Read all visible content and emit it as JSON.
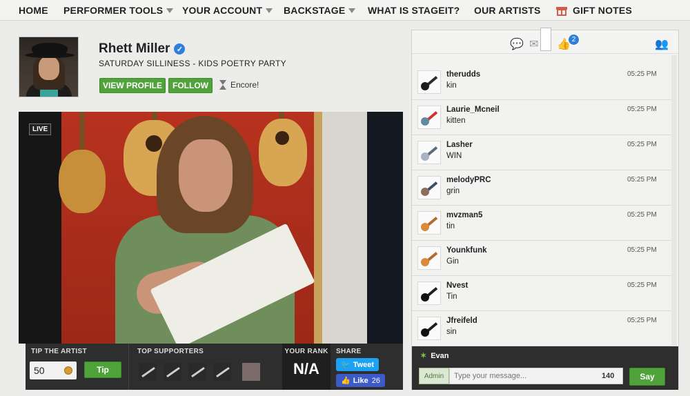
{
  "nav": {
    "home": "HOME",
    "performer_tools": "PERFORMER TOOLS",
    "your_account": "YOUR ACCOUNT",
    "backstage": "BACKSTAGE",
    "what_is": "WHAT IS STAGEIT?",
    "our_artists": "OUR ARTISTS",
    "gift_notes": "GIFT NOTES"
  },
  "profile": {
    "name": "Rhett Miller",
    "show_title": "SATURDAY SILLINESS - KIDS POETRY PARTY",
    "view_profile": "VIEW PROFILE",
    "follow": "FOLLOW",
    "encore": "Encore!"
  },
  "video": {
    "live": "LIVE"
  },
  "bottom": {
    "tip_label": "TIP THE ARTIST",
    "tip_value": "50",
    "tip_button": "Tip",
    "supporters_label": "TOP SUPPORTERS",
    "rank_label": "YOUR RANK",
    "rank_value": "N/A",
    "share_label": "SHARE",
    "tweet": "Tweet",
    "like": "Like",
    "like_count": "26"
  },
  "chat": {
    "notif_count": "2",
    "messages": [
      {
        "user": "therudds",
        "text": "kin",
        "time": "05:25 PM",
        "thumb_color": "#2b2b2b",
        "thumb_accent": "#1b1b1b"
      },
      {
        "user": "Laurie_Mcneil",
        "text": "kitten",
        "time": "05:25 PM",
        "thumb_color": "#c8382d",
        "thumb_accent": "#5f8c9c"
      },
      {
        "user": "Lasher",
        "text": "WIN",
        "time": "05:25 PM",
        "thumb_color": "#5a6b7a",
        "thumb_accent": "#a8b4c0"
      },
      {
        "user": "melodyPRC",
        "text": "grin",
        "time": "05:25 PM",
        "thumb_color": "#3d4d6a",
        "thumb_accent": "#8a6e5a"
      },
      {
        "user": "mvzman5",
        "text": "tin",
        "time": "05:25 PM",
        "thumb_color": "#b56a2b",
        "thumb_accent": "#d98a3a"
      },
      {
        "user": "Younkfunk",
        "text": "Gin",
        "time": "05:25 PM",
        "thumb_color": "#b56a2b",
        "thumb_accent": "#d98a3a"
      },
      {
        "user": "Nvest",
        "text": "Tin",
        "time": "05:25 PM",
        "thumb_color": "#1e1e1e",
        "thumb_accent": "#111111"
      },
      {
        "user": "Jfreifeld",
        "text": "sin",
        "time": "05:25 PM",
        "thumb_color": "#1e1e1e",
        "thumb_accent": "#111111"
      }
    ],
    "current_user": "Evan",
    "admin_tag": "Admin",
    "input_placeholder": "Type your message...",
    "char_count": "140",
    "say": "Say"
  },
  "colors": {
    "accent_green": "#4fa33a",
    "twitter_blue": "#1da1f2",
    "facebook_blue": "#3b5bc9",
    "badge_blue": "#2e7fd9"
  }
}
